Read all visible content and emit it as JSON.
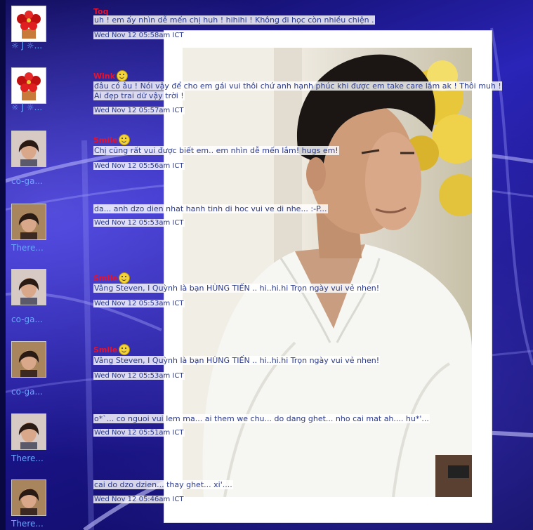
{
  "comments": [
    {
      "avatar_icon": "poinsettia-icon",
      "username": "☼ J ☼...",
      "tag": "Toq",
      "has_smiley": false,
      "message": "uh ! em ấy nhìn dễ mến chị huh ! hihihi ! Không đi học còn nhiều chiện .",
      "timestamp": "Wed Nov 12 05:58am ICT"
    },
    {
      "avatar_icon": "poinsettia-icon",
      "username": "☼ J ☼...",
      "tag": "Wink",
      "has_smiley": true,
      "message": "đâu có âu ! Nói vậy để cho em gái vui thôi chứ anh hạnh phúc khi được em take care lắm ak ! Thôi muh ! Ai đẹp trai dữ vậy trời !",
      "timestamp": "Wed Nov 12 05:57am ICT"
    },
    {
      "avatar_icon": "woman-portrait-icon",
      "username": "co-ga...",
      "tag": "Smile",
      "has_smiley": true,
      "message": "Chị cũng rất vui được biết em.. em nhìn dễ mến lắm! hugs em!",
      "timestamp": "Wed Nov 12 05:56am ICT"
    },
    {
      "avatar_icon": "woman-portrait-icon",
      "username": "There...",
      "tag": "",
      "has_smiley": false,
      "message": "da... anh dzo dien nhat hanh tinh di hoc vui ve di nhe... :-P...",
      "timestamp": "Wed Nov 12 05:53am ICT"
    },
    {
      "avatar_icon": "woman-portrait-icon",
      "username": "co-ga...",
      "tag": "Smile",
      "has_smiley": true,
      "message": "Vâng Steven, I Quỳnh là bạn HÙNG TIẾN .. hi..hi.hi Trọn ngày vui vẻ nhen!",
      "timestamp": "Wed Nov 12 05:53am ICT"
    },
    {
      "avatar_icon": "woman-portrait-icon",
      "username": "co-ga...",
      "tag": "Smile",
      "has_smiley": true,
      "message": "Vâng Steven, I Quỳnh là bạn HÙNG TIẾN .. hi..hi.hi Trọn ngày vui vẻ nhen!",
      "timestamp": "Wed Nov 12 05:53am ICT"
    },
    {
      "avatar_icon": "woman-portrait-icon",
      "username": "There...",
      "tag": "",
      "has_smiley": false,
      "message": "o*`... co nguoi vui lem ma... ai them we chu... do dang ghet... nho cai mat ah.... hu*'...",
      "timestamp": "Wed Nov 12 05:51am ICT"
    },
    {
      "avatar_icon": "woman-portrait-icon",
      "username": "There...",
      "tag": "",
      "has_smiley": false,
      "message": "cai do dzo dzien... thay ghet... xi'....",
      "timestamp": "Wed Nov 12 05:46am ICT"
    }
  ],
  "colors": {
    "background": "#1f1a9c",
    "tag": "#e8122a",
    "username": "#6aa6ff",
    "text": "#2b3a8a"
  }
}
